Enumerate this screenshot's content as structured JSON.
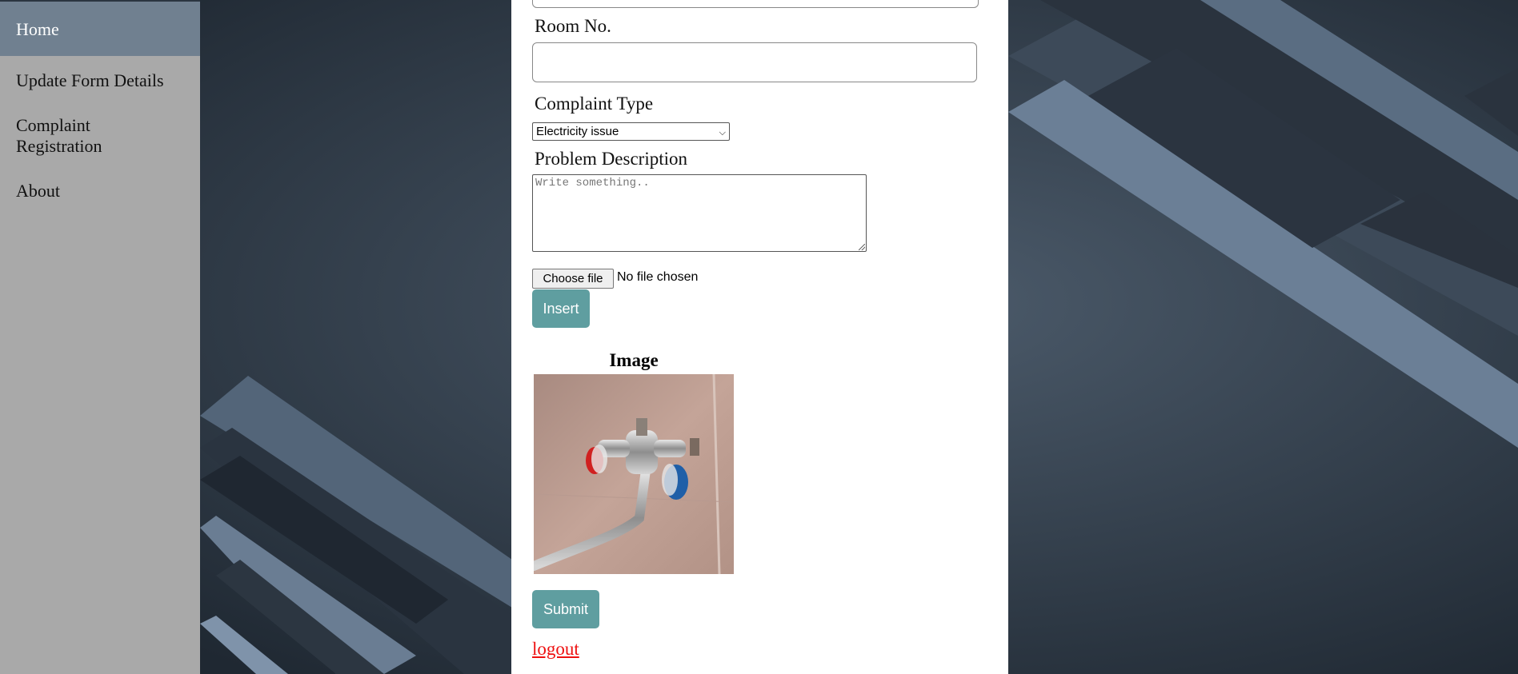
{
  "sidebar": {
    "items": [
      {
        "label": "Home",
        "active": true
      },
      {
        "label": "Update Form Details"
      },
      {
        "label": "Complaint Registration"
      },
      {
        "label": "About"
      }
    ]
  },
  "form": {
    "room_label": "Room No.",
    "room_value": "",
    "complaint_type_label": "Complaint Type",
    "complaint_type_value": "Electricity issue",
    "description_label": "Problem Description",
    "description_placeholder": "Write something..",
    "file_button": "Choose file",
    "file_status": "No file chosen",
    "insert_label": "Insert",
    "image_heading": "Image",
    "submit_label": "Submit",
    "logout_label": "logout"
  },
  "colors": {
    "sidebar_bg": "#a9a9a9",
    "sidebar_active": "#708090",
    "button": "#5f9ea0",
    "logout": "#e11111"
  }
}
